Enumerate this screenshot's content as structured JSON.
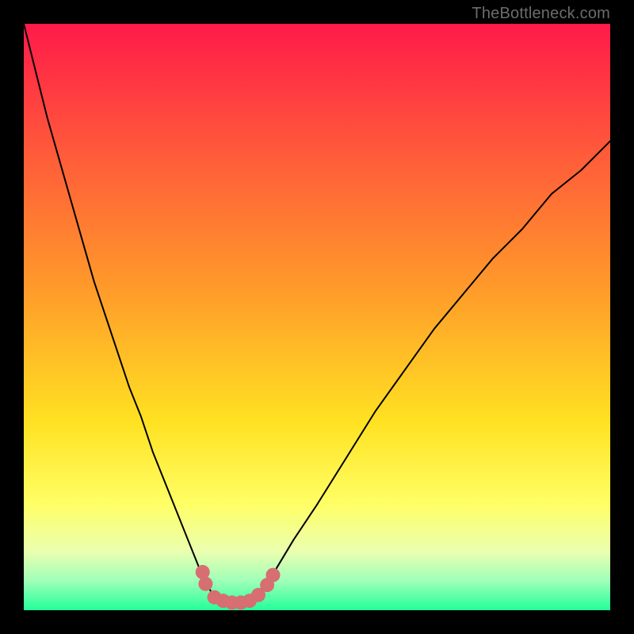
{
  "watermark": {
    "text": "TheBottleneck.com"
  },
  "chart_data": {
    "type": "line",
    "title": "",
    "xlabel": "",
    "ylabel": "",
    "xlim": [
      0,
      100
    ],
    "ylim": [
      0,
      100
    ],
    "grid": false,
    "legend": false,
    "background_gradient": {
      "direction": "vertical",
      "stops": [
        {
          "pos": 0.0,
          "color": "#ff1a49"
        },
        {
          "pos": 0.22,
          "color": "#ff5a3a"
        },
        {
          "pos": 0.45,
          "color": "#ff9a2a"
        },
        {
          "pos": 0.68,
          "color": "#ffe222"
        },
        {
          "pos": 0.82,
          "color": "#ffff66"
        },
        {
          "pos": 0.9,
          "color": "#eaffb0"
        },
        {
          "pos": 0.95,
          "color": "#9fffb8"
        },
        {
          "pos": 1.0,
          "color": "#22ff9a"
        }
      ]
    },
    "annotations": [],
    "series": [
      {
        "name": "left-branch",
        "color": "#000000",
        "width": 2,
        "x": [
          0,
          2,
          4,
          6,
          8,
          10,
          12,
          14,
          16,
          18,
          20,
          22,
          24,
          26,
          28,
          30,
          31,
          32,
          33,
          34
        ],
        "y": [
          100,
          92,
          84,
          77,
          70,
          63,
          56,
          50,
          44,
          38,
          33,
          27,
          22,
          17,
          12,
          7,
          5,
          3,
          2,
          1.5
        ]
      },
      {
        "name": "right-branch",
        "color": "#000000",
        "width": 2,
        "x": [
          38,
          40,
          43,
          46,
          50,
          55,
          60,
          65,
          70,
          75,
          80,
          85,
          90,
          95,
          100
        ],
        "y": [
          1.5,
          3,
          7,
          12,
          18,
          26,
          34,
          41,
          48,
          54,
          60,
          65,
          71,
          75,
          80
        ]
      },
      {
        "name": "valley-bottom",
        "color": "#000000",
        "width": 2,
        "x": [
          34,
          35,
          36,
          37,
          38
        ],
        "y": [
          1.5,
          1.2,
          1.1,
          1.2,
          1.5
        ]
      }
    ],
    "markers": {
      "name": "valley-dots",
      "color": "#d66e72",
      "radius": 9,
      "points": [
        {
          "x": 30.5,
          "y": 6.5
        },
        {
          "x": 31.0,
          "y": 4.5
        },
        {
          "x": 32.5,
          "y": 2.2
        },
        {
          "x": 34.0,
          "y": 1.6
        },
        {
          "x": 35.5,
          "y": 1.3
        },
        {
          "x": 37.0,
          "y": 1.3
        },
        {
          "x": 38.5,
          "y": 1.6
        },
        {
          "x": 40.0,
          "y": 2.6
        },
        {
          "x": 41.5,
          "y": 4.3
        },
        {
          "x": 42.5,
          "y": 6.0
        }
      ]
    }
  }
}
